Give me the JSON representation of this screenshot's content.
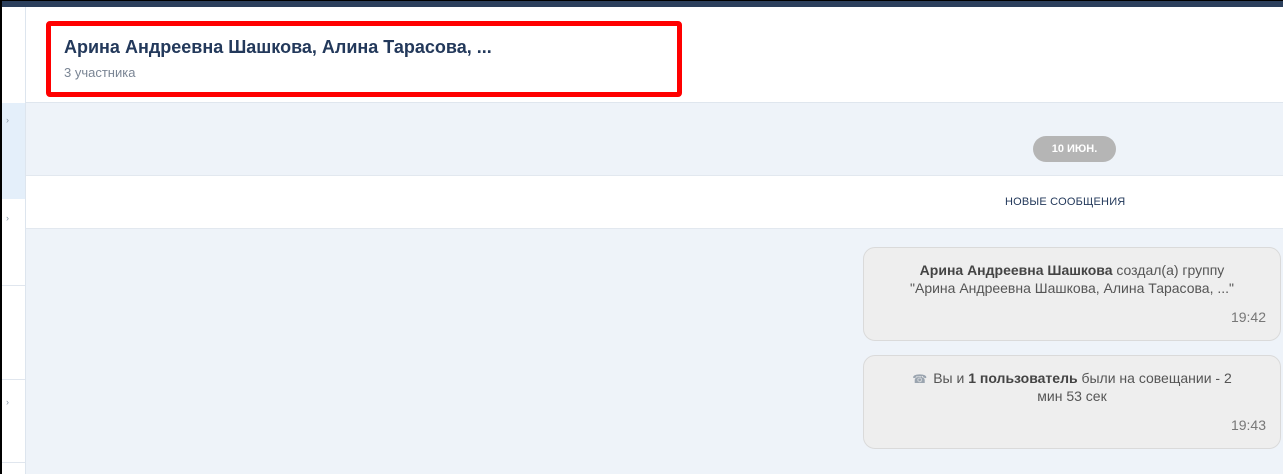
{
  "header": {
    "title": "Арина Андреевна Шашкова, Алина Тарасова, ...",
    "subtitle": "3 участника"
  },
  "chat": {
    "date_label": "10 ИЮН.",
    "new_messages_label": "НОВЫЕ СООБЩЕНИЯ",
    "messages": [
      {
        "author": "Арина Андреевна Шашкова",
        "action": "создал(а) группу",
        "group_name": "\"Арина Андреевна Шашкова, Алина Тарасова, ...\"",
        "time": "19:42"
      },
      {
        "icon": "phone-icon",
        "prefix": "Вы и",
        "participants": "1 пользователь",
        "suffix": "были на совещании - 2",
        "duration_line": "мин 53 сек",
        "time": "19:43"
      }
    ]
  },
  "colors": {
    "highlight_border": "#ff0000",
    "title_text": "#23395b",
    "background": "#eef3f9",
    "date_pill": "#b5b5b5"
  }
}
